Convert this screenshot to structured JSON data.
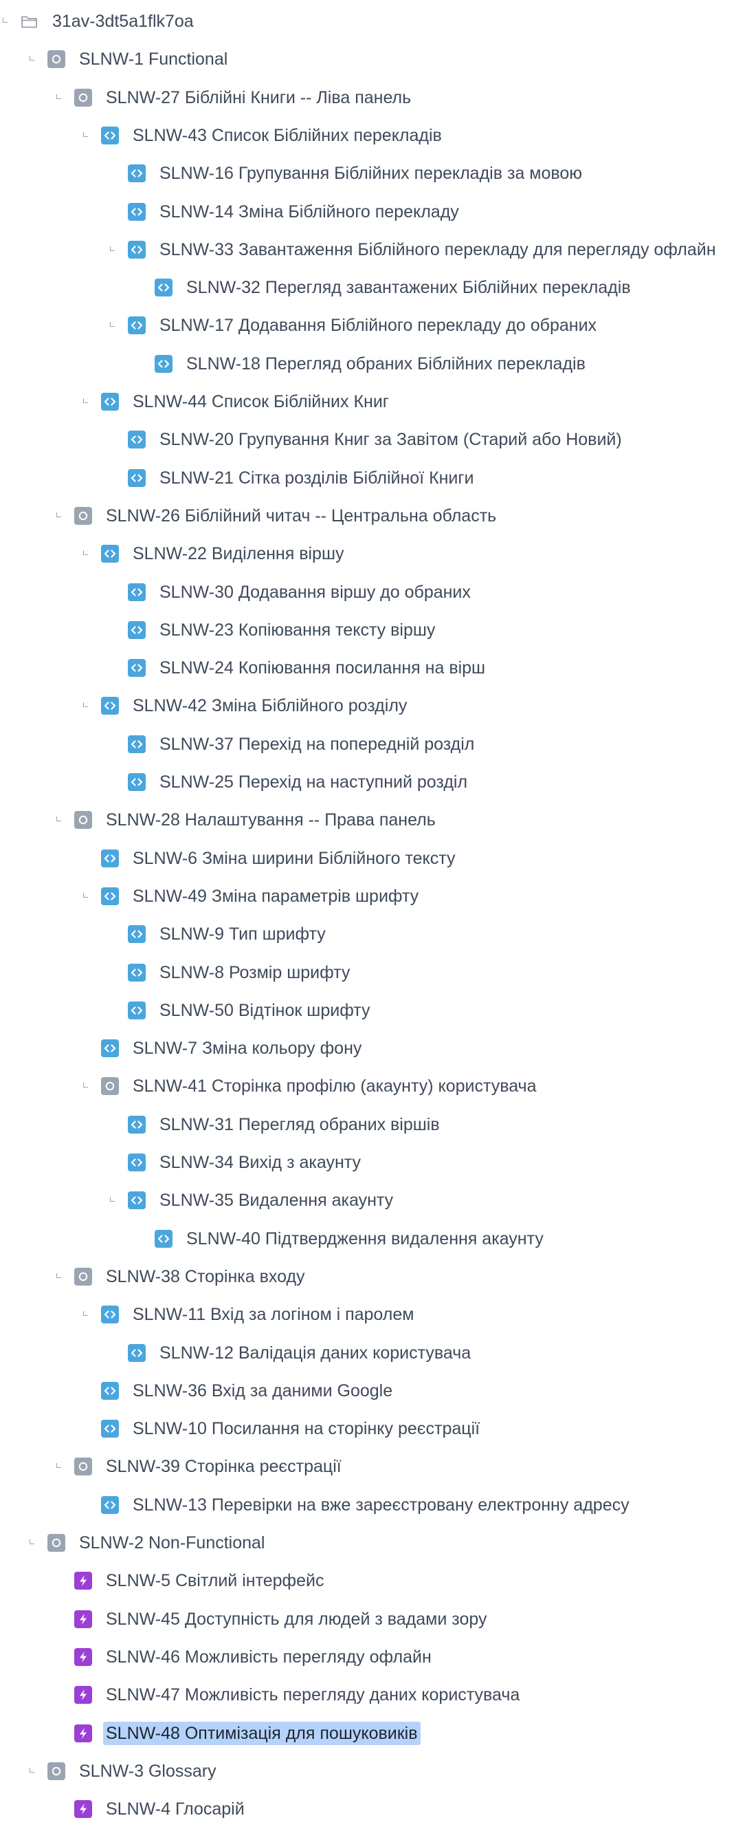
{
  "tree": {
    "selected_key": "SLNW-48",
    "colors": {
      "text": "#3f4a5a",
      "toggle": "#9aa1ac",
      "group_icon_bg": "#9aa5b1",
      "story_icon_bg": "#4ba6de",
      "nfr_icon_bg": "#9b3fd6",
      "selection_bg": "#b5d3fa"
    },
    "items": [
      {
        "depth": 0,
        "icon": "folder-icon",
        "label": "31av-3dt5a1flk7oa",
        "expanded": true
      },
      {
        "depth": 1,
        "icon": "group-icon",
        "label": "SLNW-1 Functional",
        "expanded": true
      },
      {
        "depth": 2,
        "icon": "group-icon",
        "label": "SLNW-27 Біблійні Книги -- Ліва панель",
        "expanded": true
      },
      {
        "depth": 3,
        "icon": "story-icon",
        "label": "SLNW-43 Список Біблійних перекладів",
        "expanded": true
      },
      {
        "depth": 4,
        "icon": "story-icon",
        "label": "SLNW-16 Групування Біблійних перекладів за мовою",
        "expanded": false
      },
      {
        "depth": 4,
        "icon": "story-icon",
        "label": "SLNW-14 Зміна Біблійного перекладу",
        "expanded": false
      },
      {
        "depth": 4,
        "icon": "story-icon",
        "label": "SLNW-33 Завантаження Біблійного перекладу для перегляду офлайн",
        "expanded": true
      },
      {
        "depth": 5,
        "icon": "story-icon",
        "label": "SLNW-32 Перегляд завантажених Біблійних перекладів",
        "expanded": false
      },
      {
        "depth": 4,
        "icon": "story-icon",
        "label": "SLNW-17 Додавання Біблійного перекладу до обраних",
        "expanded": true
      },
      {
        "depth": 5,
        "icon": "story-icon",
        "label": "SLNW-18 Перегляд обраних Біблійних перекладів",
        "expanded": false
      },
      {
        "depth": 3,
        "icon": "story-icon",
        "label": "SLNW-44 Список Біблійних Книг",
        "expanded": true
      },
      {
        "depth": 4,
        "icon": "story-icon",
        "label": "SLNW-20 Групування Книг за Завітом (Старий або Новий)",
        "expanded": false
      },
      {
        "depth": 4,
        "icon": "story-icon",
        "label": "SLNW-21 Сітка розділів Біблійної Книги",
        "expanded": false
      },
      {
        "depth": 2,
        "icon": "group-icon",
        "label": "SLNW-26 Біблійний читач -- Центральна область",
        "expanded": true
      },
      {
        "depth": 3,
        "icon": "story-icon",
        "label": "SLNW-22 Виділення віршу",
        "expanded": true
      },
      {
        "depth": 4,
        "icon": "story-icon",
        "label": "SLNW-30 Додавання віршу до обраних",
        "expanded": false
      },
      {
        "depth": 4,
        "icon": "story-icon",
        "label": "SLNW-23 Копіювання тексту віршу",
        "expanded": false
      },
      {
        "depth": 4,
        "icon": "story-icon",
        "label": "SLNW-24 Копіювання посилання на вірш",
        "expanded": false
      },
      {
        "depth": 3,
        "icon": "story-icon",
        "label": "SLNW-42 Зміна Біблійного розділу",
        "expanded": true
      },
      {
        "depth": 4,
        "icon": "story-icon",
        "label": "SLNW-37 Перехід на попередній розділ",
        "expanded": false
      },
      {
        "depth": 4,
        "icon": "story-icon",
        "label": "SLNW-25 Перехід на наступний розділ",
        "expanded": false
      },
      {
        "depth": 2,
        "icon": "group-icon",
        "label": "SLNW-28 Налаштування -- Права панель",
        "expanded": true
      },
      {
        "depth": 3,
        "icon": "story-icon",
        "label": "SLNW-6 Зміна ширини Біблійного тексту",
        "expanded": false
      },
      {
        "depth": 3,
        "icon": "story-icon",
        "label": "SLNW-49 Зміна параметрів шрифту",
        "expanded": true
      },
      {
        "depth": 4,
        "icon": "story-icon",
        "label": "SLNW-9 Тип шрифту",
        "expanded": false
      },
      {
        "depth": 4,
        "icon": "story-icon",
        "label": "SLNW-8 Розмір шрифту",
        "expanded": false
      },
      {
        "depth": 4,
        "icon": "story-icon",
        "label": "SLNW-50 Відтінок шрифту",
        "expanded": false
      },
      {
        "depth": 3,
        "icon": "story-icon",
        "label": "SLNW-7 Зміна кольору фону",
        "expanded": false
      },
      {
        "depth": 3,
        "icon": "group-icon",
        "label": "SLNW-41 Сторінка профілю (акаунту) користувача",
        "expanded": true
      },
      {
        "depth": 4,
        "icon": "story-icon",
        "label": "SLNW-31 Перегляд обраних віршів",
        "expanded": false
      },
      {
        "depth": 4,
        "icon": "story-icon",
        "label": "SLNW-34 Вихід з акаунту",
        "expanded": false
      },
      {
        "depth": 4,
        "icon": "story-icon",
        "label": "SLNW-35 Видалення акаунту",
        "expanded": true
      },
      {
        "depth": 5,
        "icon": "story-icon",
        "label": "SLNW-40 Підтвердження видалення акаунту",
        "expanded": false
      },
      {
        "depth": 2,
        "icon": "group-icon",
        "label": "SLNW-38 Сторінка входу",
        "expanded": true
      },
      {
        "depth": 3,
        "icon": "story-icon",
        "label": "SLNW-11 Вхід за логіном і паролем",
        "expanded": true
      },
      {
        "depth": 4,
        "icon": "story-icon",
        "label": "SLNW-12 Валідація даних користувача",
        "expanded": false
      },
      {
        "depth": 3,
        "icon": "story-icon",
        "label": "SLNW-36 Вхід за даними Google",
        "expanded": false
      },
      {
        "depth": 3,
        "icon": "story-icon",
        "label": "SLNW-10 Посилання на сторінку реєстрації",
        "expanded": false
      },
      {
        "depth": 2,
        "icon": "group-icon",
        "label": "SLNW-39 Сторінка реєстрації",
        "expanded": true
      },
      {
        "depth": 3,
        "icon": "story-icon",
        "label": "SLNW-13 Перевірки на вже зареєстровану електронну адресу",
        "expanded": false
      },
      {
        "depth": 1,
        "icon": "group-icon",
        "label": "SLNW-2 Non-Functional",
        "expanded": true
      },
      {
        "depth": 2,
        "icon": "nfr-icon",
        "label": "SLNW-5 Світлий інтерфейс",
        "expanded": false
      },
      {
        "depth": 2,
        "icon": "nfr-icon",
        "label": "SLNW-45 Доступність для людей з вадами зору",
        "expanded": false
      },
      {
        "depth": 2,
        "icon": "nfr-icon",
        "label": "SLNW-46 Можливість перегляду офлайн",
        "expanded": false
      },
      {
        "depth": 2,
        "icon": "nfr-icon",
        "label": "SLNW-47 Можливість перегляду даних користувача",
        "expanded": false
      },
      {
        "depth": 2,
        "icon": "nfr-icon",
        "label": "SLNW-48 Оптимізація для пошуковиків",
        "expanded": false
      },
      {
        "depth": 1,
        "icon": "group-icon",
        "label": "SLNW-3 Glossary",
        "expanded": true
      },
      {
        "depth": 2,
        "icon": "nfr-icon",
        "label": "SLNW-4 Глосарій",
        "expanded": false
      }
    ]
  }
}
